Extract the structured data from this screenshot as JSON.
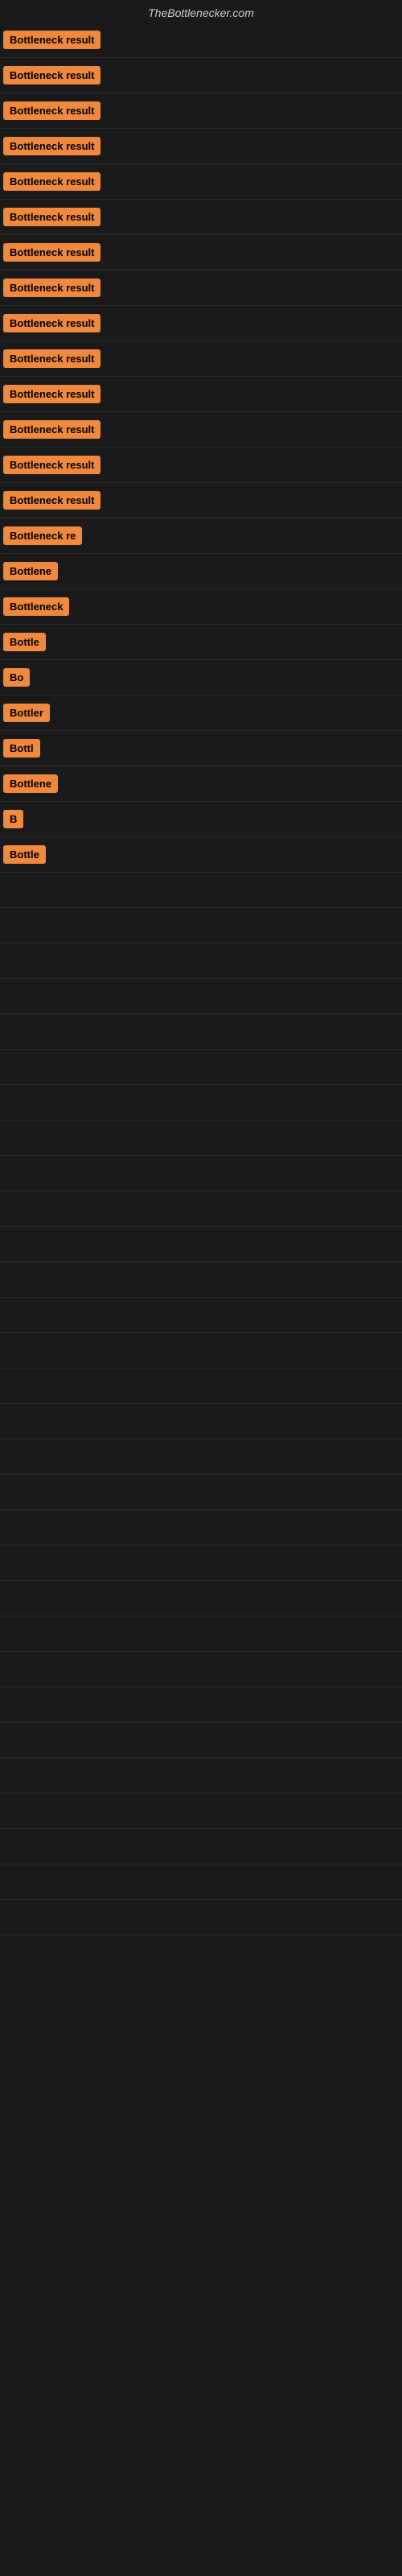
{
  "site": {
    "title": "TheBottlenecker.com"
  },
  "accent_color": "#f0883e",
  "rows": [
    {
      "id": 1,
      "label": "Bottleneck result",
      "visible_chars": 16
    },
    {
      "id": 2,
      "label": "Bottleneck result",
      "visible_chars": 16
    },
    {
      "id": 3,
      "label": "Bottleneck result",
      "visible_chars": 16
    },
    {
      "id": 4,
      "label": "Bottleneck result",
      "visible_chars": 16
    },
    {
      "id": 5,
      "label": "Bottleneck result",
      "visible_chars": 16
    },
    {
      "id": 6,
      "label": "Bottleneck result",
      "visible_chars": 16
    },
    {
      "id": 7,
      "label": "Bottleneck result",
      "visible_chars": 16
    },
    {
      "id": 8,
      "label": "Bottleneck result",
      "visible_chars": 16
    },
    {
      "id": 9,
      "label": "Bottleneck result",
      "visible_chars": 16
    },
    {
      "id": 10,
      "label": "Bottleneck result",
      "visible_chars": 16
    },
    {
      "id": 11,
      "label": "Bottleneck result",
      "visible_chars": 16
    },
    {
      "id": 12,
      "label": "Bottleneck result",
      "visible_chars": 16
    },
    {
      "id": 13,
      "label": "Bottleneck result",
      "visible_chars": 16
    },
    {
      "id": 14,
      "label": "Bottleneck result",
      "visible_chars": 16
    },
    {
      "id": 15,
      "label": "Bottleneck re",
      "visible_chars": 13
    },
    {
      "id": 16,
      "label": "Bottlene",
      "visible_chars": 8
    },
    {
      "id": 17,
      "label": "Bottleneck",
      "visible_chars": 10
    },
    {
      "id": 18,
      "label": "Bottle",
      "visible_chars": 6
    },
    {
      "id": 19,
      "label": "Bo",
      "visible_chars": 2
    },
    {
      "id": 20,
      "label": "Bottler",
      "visible_chars": 7
    },
    {
      "id": 21,
      "label": "Bottl",
      "visible_chars": 5
    },
    {
      "id": 22,
      "label": "Bottlene",
      "visible_chars": 8
    },
    {
      "id": 23,
      "label": "B",
      "visible_chars": 1
    },
    {
      "id": 24,
      "label": "Bottle",
      "visible_chars": 6
    }
  ]
}
